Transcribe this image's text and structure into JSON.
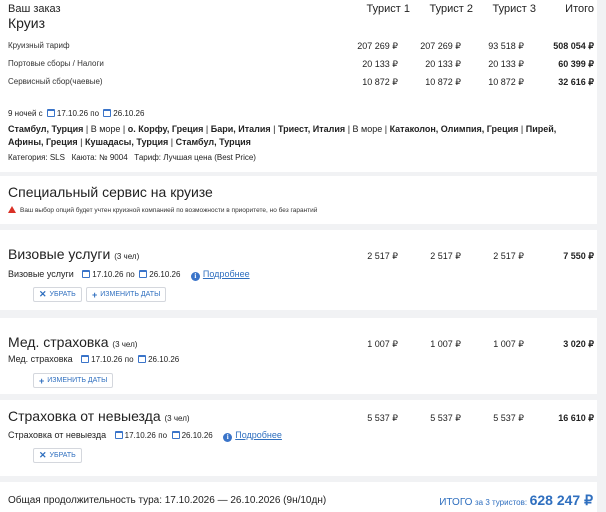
{
  "order": {
    "header": "Ваш заказ",
    "title": "Круиз",
    "columns": [
      "Турист 1",
      "Турист 2",
      "Турист 3",
      "Итого"
    ],
    "rows": [
      {
        "label": "Круизный тариф",
        "values": [
          "207 269 ₽",
          "207 269 ₽",
          "93 518 ₽",
          "508 054 ₽"
        ]
      },
      {
        "label": "Портовые сборы / Налоги",
        "values": [
          "20 133 ₽",
          "20 133 ₽",
          "20 133 ₽",
          "60 399 ₽"
        ]
      },
      {
        "label": "Сервисный сбор(чаевые)",
        "values": [
          "10 872 ₽",
          "10 872 ₽",
          "10 872 ₽",
          "32 616 ₽"
        ]
      }
    ],
    "nights": "9 ночей с",
    "date_from": "17.10.26",
    "by": "по",
    "date_to": "26.10.26",
    "route_line1": [
      {
        "t": "Стамбул, Турция",
        "b": true
      },
      {
        "t": " | В море | ",
        "b": false
      },
      {
        "t": "о. Корфу, Греция",
        "b": true
      },
      {
        "t": " | ",
        "b": false
      },
      {
        "t": "Бари, Италия",
        "b": true
      },
      {
        "t": " | ",
        "b": false
      },
      {
        "t": "Триест, Италия",
        "b": true
      },
      {
        "t": " | В море | ",
        "b": false
      },
      {
        "t": "Катаколон, Олимпия, Греция",
        "b": true
      },
      {
        "t": " | ",
        "b": false
      },
      {
        "t": "Пирей,",
        "b": true
      }
    ],
    "route_line2": [
      {
        "t": "Афины, Греция",
        "b": true
      },
      {
        "t": " | ",
        "b": false
      },
      {
        "t": "Кушадасы, Турция",
        "b": true
      },
      {
        "t": " | ",
        "b": false
      },
      {
        "t": "Стамбул, Турция",
        "b": true
      }
    ],
    "category": "Категория: SLS   Каюта: № 9004   Тариф: Лучшая цена (Best Price)"
  },
  "special": {
    "title": "Специальный сервис на круизе",
    "warning": "Ваш выбор опций будет учтен круизной компанией по возможности в приоритете, но без гарантий"
  },
  "visa": {
    "title": "Визовые услуги",
    "count": "(3 чел)",
    "values": [
      "2 517 ₽",
      "2 517 ₽",
      "2 517 ₽",
      "7 550 ₽"
    ],
    "label": "Визовые услуги",
    "date_from": "17.10.26",
    "by": "по",
    "date_to": "26.10.26",
    "more": "Подробнее",
    "remove": "УБРАТЬ",
    "change": "ИЗМЕНИТЬ ДАТЫ"
  },
  "med": {
    "title": "Мед. страховка",
    "count": "(3 чел)",
    "values": [
      "1 007 ₽",
      "1 007 ₽",
      "1 007 ₽",
      "3 020 ₽"
    ],
    "label": "Мед. страховка",
    "date_from": "17.10.26",
    "by": "по",
    "date_to": "26.10.26",
    "change": "ИЗМЕНИТЬ ДАТЫ"
  },
  "cancel": {
    "title": "Страховка от невыезда",
    "count": "(3 чел)",
    "values": [
      "5 537 ₽",
      "5 537 ₽",
      "5 537 ₽",
      "16 610 ₽"
    ],
    "label": "Страховка от невыезда",
    "date_from": "17.10.26",
    "by": "по",
    "date_to": "26.10.26",
    "more": "Подробнее",
    "remove": "УБРАТЬ"
  },
  "footer": {
    "duration": "Общая продолжительность тура: 17.10.2026 — 26.10.2026 (9н/10дн)",
    "total_label": "ИТОГО",
    "total_for": "за 3 туристов:",
    "total": "628 247 ₽"
  },
  "colors": {
    "accent": "#2f6fbf",
    "warning": "#d93025",
    "background": "#f1f2f4"
  }
}
